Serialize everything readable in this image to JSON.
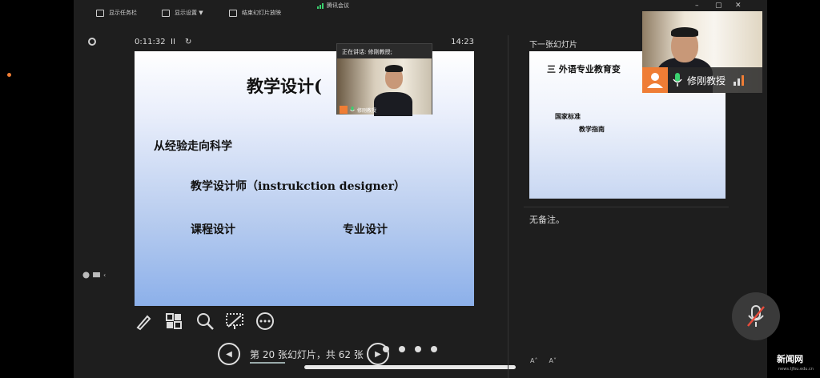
{
  "app": {
    "title": "腾讯会议",
    "accent_color": "#ef7d35",
    "signal_color": "#3bd16f"
  },
  "toolbar": {
    "show_taskbar": "显示任务栏",
    "display_settings": "显示设置 ▼",
    "end_slideshow": "结束幻灯片放映"
  },
  "window_controls": {
    "minimize": "–",
    "maximize": "▢",
    "close": "✕"
  },
  "presenter": {
    "elapsed_time": "0:11:32",
    "pause_symbol": "II",
    "reset_symbol": "↻",
    "clock": "14:23"
  },
  "current_slide": {
    "title": "教学设计(",
    "line1": "从经验走向科学",
    "line2": "教学设计师（instrukction designer）",
    "line3": "课程设计",
    "line4": "专业设计"
  },
  "speaking_popup": {
    "header": "正在讲话: 修刚教授;",
    "name": "修刚教授"
  },
  "navigation": {
    "prev_symbol": "◀",
    "next_symbol": "▶",
    "slide_counter": "第 20 张幻灯片，共 62 张"
  },
  "side_panel": {
    "next_slide_label": "下一张幻灯片",
    "notes": "无备注。",
    "font_increase": "A˄",
    "font_decrease": "A˅"
  },
  "next_slide": {
    "title": "三  外语专业教育变",
    "line1": "国家标准",
    "line2": "教学指南"
  },
  "camera_tile": {
    "name": "修刚教授"
  },
  "left_edge": {
    "icons_label": "‹"
  },
  "watermark": {
    "text": "新闻网",
    "sub": "news.tjfsu.edu.cn"
  }
}
